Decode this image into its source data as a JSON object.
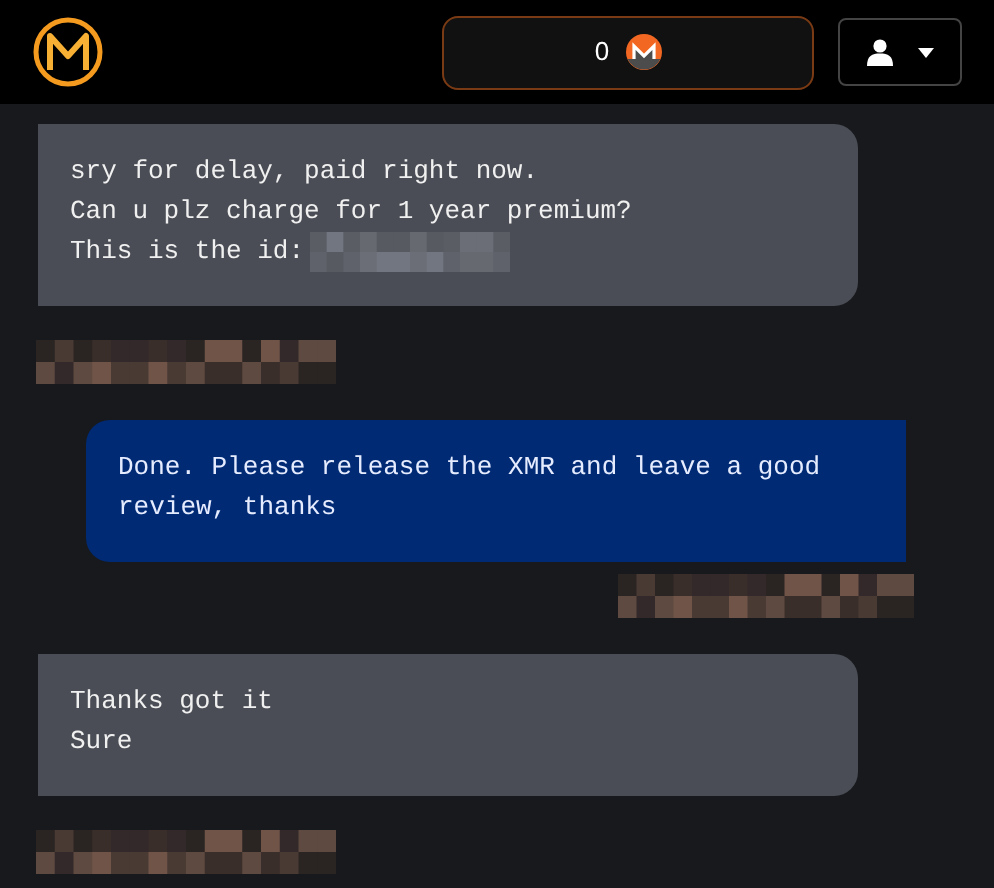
{
  "header": {
    "balance": "0"
  },
  "messages": [
    {
      "kind": "incoming",
      "lines": [
        {
          "text": "sry for delay, paid right now.",
          "redacted": false
        },
        {
          "text": "Can u plz charge for 1 year premium?",
          "redacted": false
        },
        {
          "text": "This is the id:",
          "redacted": true
        }
      ]
    },
    {
      "kind": "outgoing",
      "lines": [
        {
          "text": "Done. Please release the XMR and leave a good review, thanks",
          "redacted": false
        }
      ]
    },
    {
      "kind": "incoming",
      "lines": [
        {
          "text": "Thanks got it",
          "redacted": false
        },
        {
          "text": "Sure",
          "redacted": false
        }
      ]
    }
  ]
}
